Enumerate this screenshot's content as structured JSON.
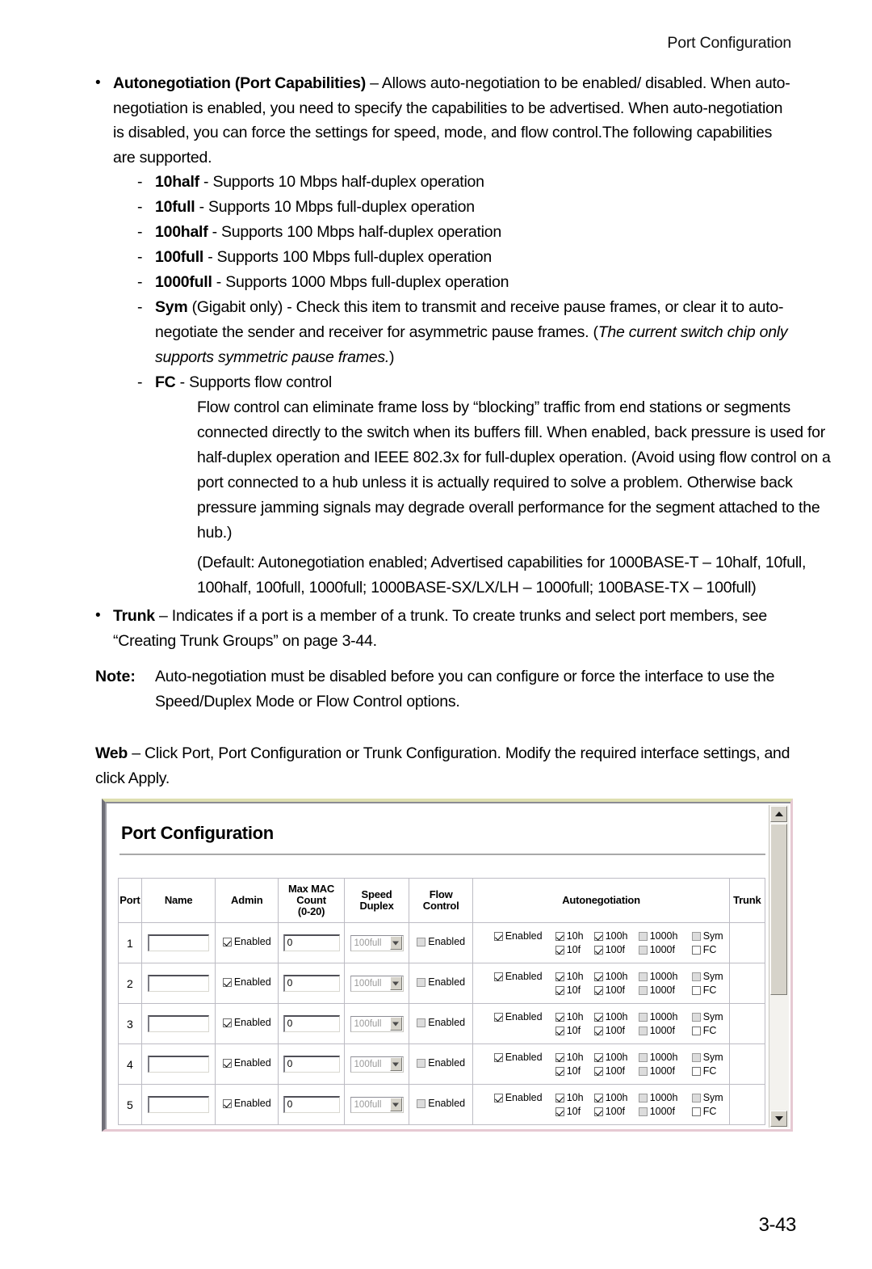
{
  "running_head": "Port Configuration",
  "folio": "3-43",
  "bullets": {
    "autoneg": {
      "term": "Autonegotiation (Port Capabilities)",
      "text": " – Allows auto-negotiation to be enabled/ disabled. When auto-negotiation is enabled, you need to specify the capabilities to be advertised. When auto-negotiation is disabled, you can force the settings for speed, mode, and flow control.The following capabilities are supported."
    },
    "trunk": {
      "term": "Trunk",
      "text": " – Indicates if a port is a member of a trunk. To create trunks and select port members, see “Creating Trunk Groups” on page 3-44."
    }
  },
  "capabilities": [
    {
      "mark": "-",
      "term": "10half",
      "text": " - Supports 10 Mbps half-duplex operation"
    },
    {
      "mark": "-",
      "term": "10full",
      "text": " - Supports 10 Mbps full-duplex operation"
    },
    {
      "mark": "-",
      "term": "100half",
      "text": " - Supports 100 Mbps half-duplex operation"
    },
    {
      "mark": "-",
      "term": "100full",
      "text": " - Supports 100 Mbps full-duplex operation"
    },
    {
      "mark": "-",
      "term": "1000full",
      "text": " - Supports 1000 Mbps full-duplex operation"
    }
  ],
  "sym_item": {
    "mark": "-",
    "term": "Sym",
    "text_before": " (Gigabit only) - Check this item to transmit and receive pause frames, or clear it to auto-negotiate the sender and receiver for asymmetric pause frames. (",
    "text_italic": "The current switch chip only supports symmetric pause frames.",
    "text_after": ")"
  },
  "fc_item": {
    "mark": "-",
    "term": "FC",
    "text": " - Supports flow control"
  },
  "fc_paragraph": "Flow control can eliminate frame loss by “blocking” traffic from end stations or segments connected directly to the switch when its buffers fill. When enabled, back pressure is used for half-duplex operation and IEEE 802.3x for full-duplex operation. (Avoid using flow control on a port connected to a hub unless it is actually required to solve a problem. Otherwise back pressure jamming signals may degrade overall performance for the segment attached to the hub.)",
  "default_paragraph": "(Default: Autonegotiation enabled; Advertised capabilities for 1000BASE-T – 10half, 10full, 100half, 100full, 1000full; 1000BASE-SX/LX/LH – 1000full; 100BASE-TX – 100full)",
  "note": {
    "label": "Note:",
    "text": "Auto-negotiation must be disabled before you can configure or force the interface to use the Speed/Duplex Mode or Flow Control options."
  },
  "web": {
    "label": "Web",
    "text": " – Click Port, Port Configuration or Trunk Configuration. Modify the required interface settings, and click Apply."
  },
  "screenshot": {
    "title": "Port Configuration",
    "scrollbar": {
      "up_icon": "triangle-up-icon",
      "down_icon": "triangle-down-icon"
    },
    "table": {
      "headers": {
        "port": "Port",
        "name": "Name",
        "admin": "Admin",
        "max_mac": "Max MAC\nCount\n(0-20)",
        "max_mac_l1": "Max MAC",
        "max_mac_l2": "Count",
        "max_mac_l3": "(0-20)",
        "speed_l1": "Speed",
        "speed_l2": "Duplex",
        "flow_l1": "Flow",
        "flow_l2": "Control",
        "autonegotiation": "Autonegotiation",
        "trunk": "Trunk"
      },
      "labels": {
        "enabled": "Enabled",
        "c10h": "10h",
        "c100h": "100h",
        "c1000h": "1000h",
        "sym": "Sym",
        "c10f": "10f",
        "c100f": "100f",
        "c1000f": "1000f",
        "fc": "FC"
      },
      "rows": [
        {
          "port": "1",
          "name": "",
          "name_placeholder": "",
          "admin_checked": true,
          "admin_label": "Enabled",
          "max_mac": "0",
          "speed_duplex": "100full",
          "speed_disabled": true,
          "flow_checked": false,
          "flow_disabled": true,
          "flow_label": "Enabled",
          "auto": {
            "enabled": "checked",
            "c10h": "checked",
            "c100h": "checked",
            "c1000h": "dim",
            "sym": "dim",
            "c10f": "checked",
            "c100f": "checked",
            "c1000f": "dim",
            "fc": "unchecked"
          },
          "trunk": ""
        },
        {
          "port": "2",
          "name": "",
          "name_placeholder": "",
          "admin_checked": true,
          "admin_label": "Enabled",
          "max_mac": "0",
          "speed_duplex": "100full",
          "speed_disabled": true,
          "flow_checked": false,
          "flow_disabled": true,
          "flow_label": "Enabled",
          "auto": {
            "enabled": "checked",
            "c10h": "checked",
            "c100h": "checked",
            "c1000h": "dim",
            "sym": "dim",
            "c10f": "checked",
            "c100f": "checked",
            "c1000f": "dim",
            "fc": "unchecked"
          },
          "trunk": ""
        },
        {
          "port": "3",
          "name": "",
          "name_placeholder": "",
          "admin_checked": true,
          "admin_label": "Enabled",
          "max_mac": "0",
          "speed_duplex": "100full",
          "speed_disabled": true,
          "flow_checked": false,
          "flow_disabled": true,
          "flow_label": "Enabled",
          "auto": {
            "enabled": "checked",
            "c10h": "checked",
            "c100h": "checked",
            "c1000h": "dim",
            "sym": "dim",
            "c10f": "checked",
            "c100f": "checked",
            "c1000f": "dim",
            "fc": "unchecked"
          },
          "trunk": ""
        },
        {
          "port": "4",
          "name": "",
          "name_placeholder": "",
          "admin_checked": true,
          "admin_label": "Enabled",
          "max_mac": "0",
          "speed_duplex": "100full",
          "speed_disabled": true,
          "flow_checked": false,
          "flow_disabled": true,
          "flow_label": "Enabled",
          "auto": {
            "enabled": "checked",
            "c10h": "checked",
            "c100h": "checked",
            "c1000h": "dim",
            "sym": "dim",
            "c10f": "checked",
            "c100f": "checked",
            "c1000f": "dim",
            "fc": "unchecked"
          },
          "trunk": ""
        },
        {
          "port": "5",
          "name": "",
          "name_placeholder": "",
          "admin_checked": true,
          "admin_label": "Enabled",
          "max_mac": "0",
          "speed_duplex": "100full",
          "speed_disabled": true,
          "flow_checked": false,
          "flow_disabled": true,
          "flow_label": "Enabled",
          "auto": {
            "enabled": "checked",
            "c10h": "checked",
            "c100h": "checked",
            "c1000h": "dim",
            "sym": "dim",
            "c10f": "checked",
            "c100f": "checked",
            "c1000f": "dim",
            "fc": "unchecked"
          },
          "trunk": ""
        }
      ]
    }
  },
  "colors": {
    "page_bg": "#ffffff",
    "text": "#000000",
    "panel_border_top": "#dedfb0",
    "panel_border_left": "#6f6f77",
    "panel_border_pink": "#e6c9d2",
    "table_border": "#bdbcc4",
    "disabled_fill": "#dcdcdc",
    "scroll_face": "#d6d3ca",
    "scroll_track": "#f3f2ee"
  }
}
